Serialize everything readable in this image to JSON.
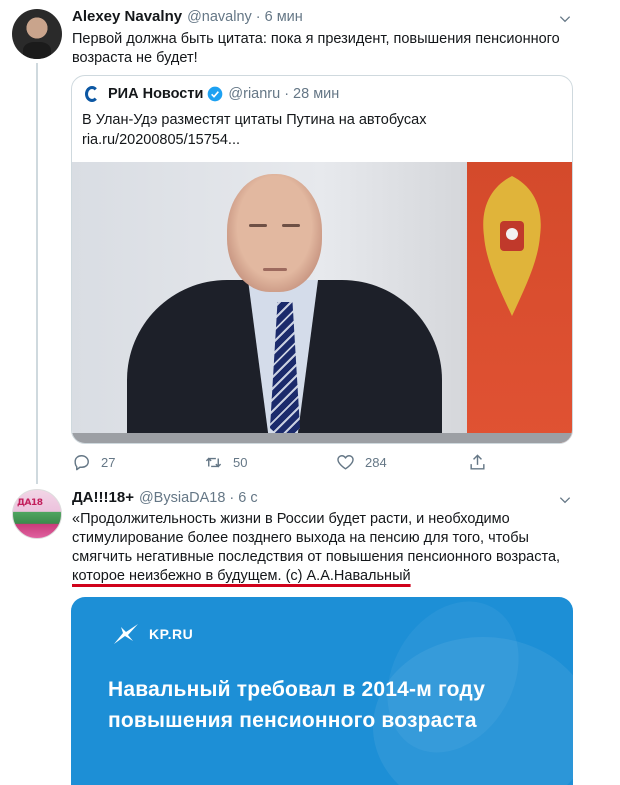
{
  "tweet1": {
    "name": "Alexey Navalny",
    "handle": "@navalny",
    "time": "6 мин",
    "text": "Первой должна быть цитата: пока я президент, повышения пенсионного возраста не будет!",
    "quote": {
      "name": "РИА Новости",
      "handle": "@rianru",
      "time": "28 мин",
      "text_line1": "В Улан-Удэ разместят цитаты Путина на автобусах",
      "text_line2": "ria.ru/20200805/15754..."
    },
    "actions": {
      "replies": "27",
      "retweets": "50",
      "likes": "284"
    }
  },
  "tweet2": {
    "name": "ДА!!!18+",
    "handle": "@BysiaDA18",
    "time": "6 с",
    "text_main": "«Продолжительность жизни в России будет расти, и необходимо стимулирование более позднего выхода на пенсию для того, чтобы смягчить негативные последствия от повышения пенсионного возраста,",
    "text_underlined": "которое неизбежно в будущем. (с) А.А.Навальный",
    "card": {
      "brand": "KP.RU",
      "headline": "Навальный требовал в 2014-м году повышения пенсионного возраста"
    }
  },
  "icons": {
    "reply": "reply-icon",
    "retweet": "retweet-icon",
    "like": "heart-icon",
    "share": "share-icon",
    "caret": "chevron-down-icon",
    "verified": "verified-badge-icon"
  },
  "colors": {
    "accent": "#1da1f2",
    "secondary_text": "#657786",
    "underline": "#d0021b",
    "card_bg": "#1d8fd6"
  }
}
